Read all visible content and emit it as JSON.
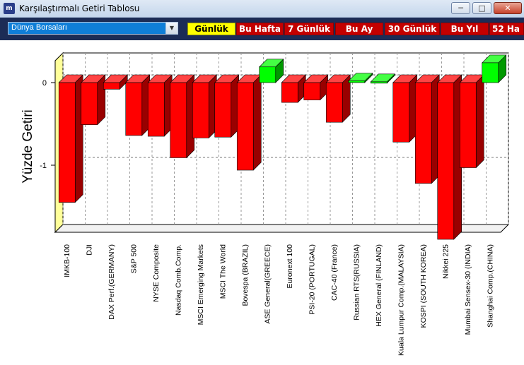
{
  "window": {
    "title": "Karşılaştırmalı Getiri Tablosu",
    "icon_label": "m",
    "controls": [
      "minimize-icon",
      "maximize-icon",
      "close-icon"
    ]
  },
  "toolbar": {
    "market_select": {
      "value": "Dünya Borsaları"
    },
    "periods": [
      {
        "label": "Günlük",
        "active": true
      },
      {
        "label": "Bu Hafta",
        "active": false
      },
      {
        "label": "7 Günlük",
        "active": false
      },
      {
        "label": "Bu Ay",
        "active": false
      },
      {
        "label": "30 Günlük",
        "active": false
      },
      {
        "label": "Bu Yıl",
        "active": false
      },
      {
        "label": "52 Ha",
        "active": false
      }
    ]
  },
  "colors": {
    "negative": "#ff0000",
    "positive": "#00ff00",
    "active_tab": "#ffff00",
    "tab": "#c40000",
    "toolbar_bg": "#1c2c56"
  },
  "chart_data": {
    "type": "bar",
    "ylabel": "Yüzde Getiri",
    "y_ticks": [
      "0",
      "-1"
    ],
    "ylim": [
      -1.9,
      0.35
    ],
    "grid": true,
    "categories": [
      "IMKB-100",
      "DJI",
      "DAX Perf.(GERMANY)",
      "S&P 500",
      "NYSE Composite",
      "Nasdaq Comb.Comp.",
      "MSCI Emerging Markets",
      "MSCI The World",
      "Bovespa (BRAZIL)",
      "ASE General(GREECE)",
      "Euronext 100",
      "PSI-20 (PORTUGAL)",
      "CAC-40 (France)",
      "Russian RTS(RUSSIA)",
      "HEX General (FINLAND)",
      "Kuala Lumpur Comp.(MALAYSIA)",
      "KOSPI (SOUTH KOREA)",
      "Nikkei 225",
      "Mumbai Sensex-30 (INDIA)",
      "Shanghai Comp.(CHINA)"
    ],
    "values": [
      -1.45,
      -0.51,
      -0.08,
      -0.64,
      -0.65,
      -0.91,
      -0.67,
      -0.66,
      -1.06,
      0.19,
      -0.24,
      -0.21,
      -0.48,
      0.02,
      0.01,
      -0.72,
      -1.22,
      -1.98,
      -1.03,
      0.24
    ]
  }
}
